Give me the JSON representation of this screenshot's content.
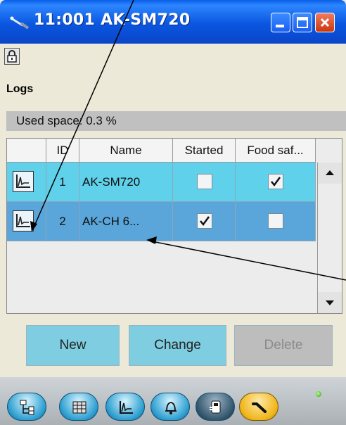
{
  "window": {
    "title": "11:001 AK-SM720"
  },
  "section": {
    "title": "Logs",
    "used_space": "Used space: 0.3 %"
  },
  "table": {
    "headers": [
      "",
      "ID",
      "Name",
      "Started",
      "Food saf..."
    ],
    "rows": [
      {
        "id": "1",
        "name": "AK-SM720",
        "started": false,
        "food_safety": true
      },
      {
        "id": "2",
        "name": "AK-CH 6...",
        "started": true,
        "food_safety": false
      }
    ]
  },
  "actions": {
    "new_label": "New",
    "change_label": "Change",
    "delete_label": "Delete"
  },
  "nav": {
    "items": [
      "network-icon",
      "calendar-grid-icon",
      "graph-icon",
      "alarm-bell-icon",
      "device-icon",
      "service-wrench-icon"
    ],
    "active": "service-wrench-icon"
  },
  "colors": {
    "title_bar": "#0a56e0",
    "row_1": "#5fd1ea",
    "row_2_selected": "#5aa5d9",
    "button": "#7fcde0",
    "button_disabled": "#bdbdbd"
  }
}
